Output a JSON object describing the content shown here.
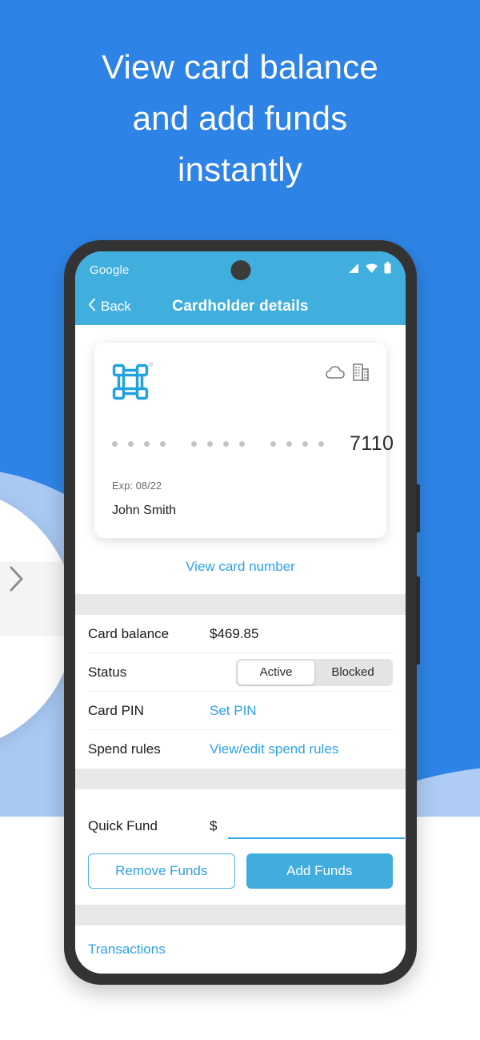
{
  "headline": {
    "line1": "View card balance",
    "line2": "and add funds",
    "line3": "instantly"
  },
  "carousel": {
    "prev_arrow_icon": "chevron-right-icon"
  },
  "phone": {
    "statusbar": {
      "carrier": "Google",
      "icons": [
        "signal-icon",
        "wifi-icon",
        "battery-icon"
      ]
    },
    "appbar": {
      "back_label": "Back",
      "back_icon": "chevron-left-icon",
      "title": "Cardholder details"
    }
  },
  "card": {
    "logo_icon": "command-loop-logo-icon",
    "registered_mark": "®",
    "top_icons": [
      "cloud-icon",
      "building-icon"
    ],
    "masked_groups": [
      4,
      4,
      4
    ],
    "last4": "7110",
    "expiry": "Exp: 08/22",
    "holder_name": "John Smith",
    "view_card_number_link": "View card number"
  },
  "details": {
    "rows": [
      {
        "label": "Card balance",
        "value": "$469.85",
        "is_link": false
      },
      {
        "label": "Status",
        "value": "",
        "is_link": false
      },
      {
        "label": "Card PIN",
        "value": "Set PIN",
        "is_link": true
      },
      {
        "label": "Spend rules",
        "value": "View/edit spend rules",
        "is_link": true
      }
    ],
    "status_segment": {
      "options": [
        "Active",
        "Blocked"
      ],
      "selected": "Active"
    }
  },
  "quick_fund": {
    "label": "Quick Fund",
    "currency_symbol": "$",
    "value": "",
    "placeholder": ""
  },
  "actions": {
    "remove_funds": "Remove Funds",
    "add_funds": "Add Funds"
  },
  "footer": {
    "transactions_link": "Transactions"
  },
  "colors": {
    "background_blue": "#2E84E6",
    "light_blue_wave": "#AECCF4",
    "app_accent": "#41AFDD",
    "link_blue": "#2EA3E6",
    "card_logo_blue": "#1FA2DF",
    "gray_band": "#E8E8E8"
  }
}
